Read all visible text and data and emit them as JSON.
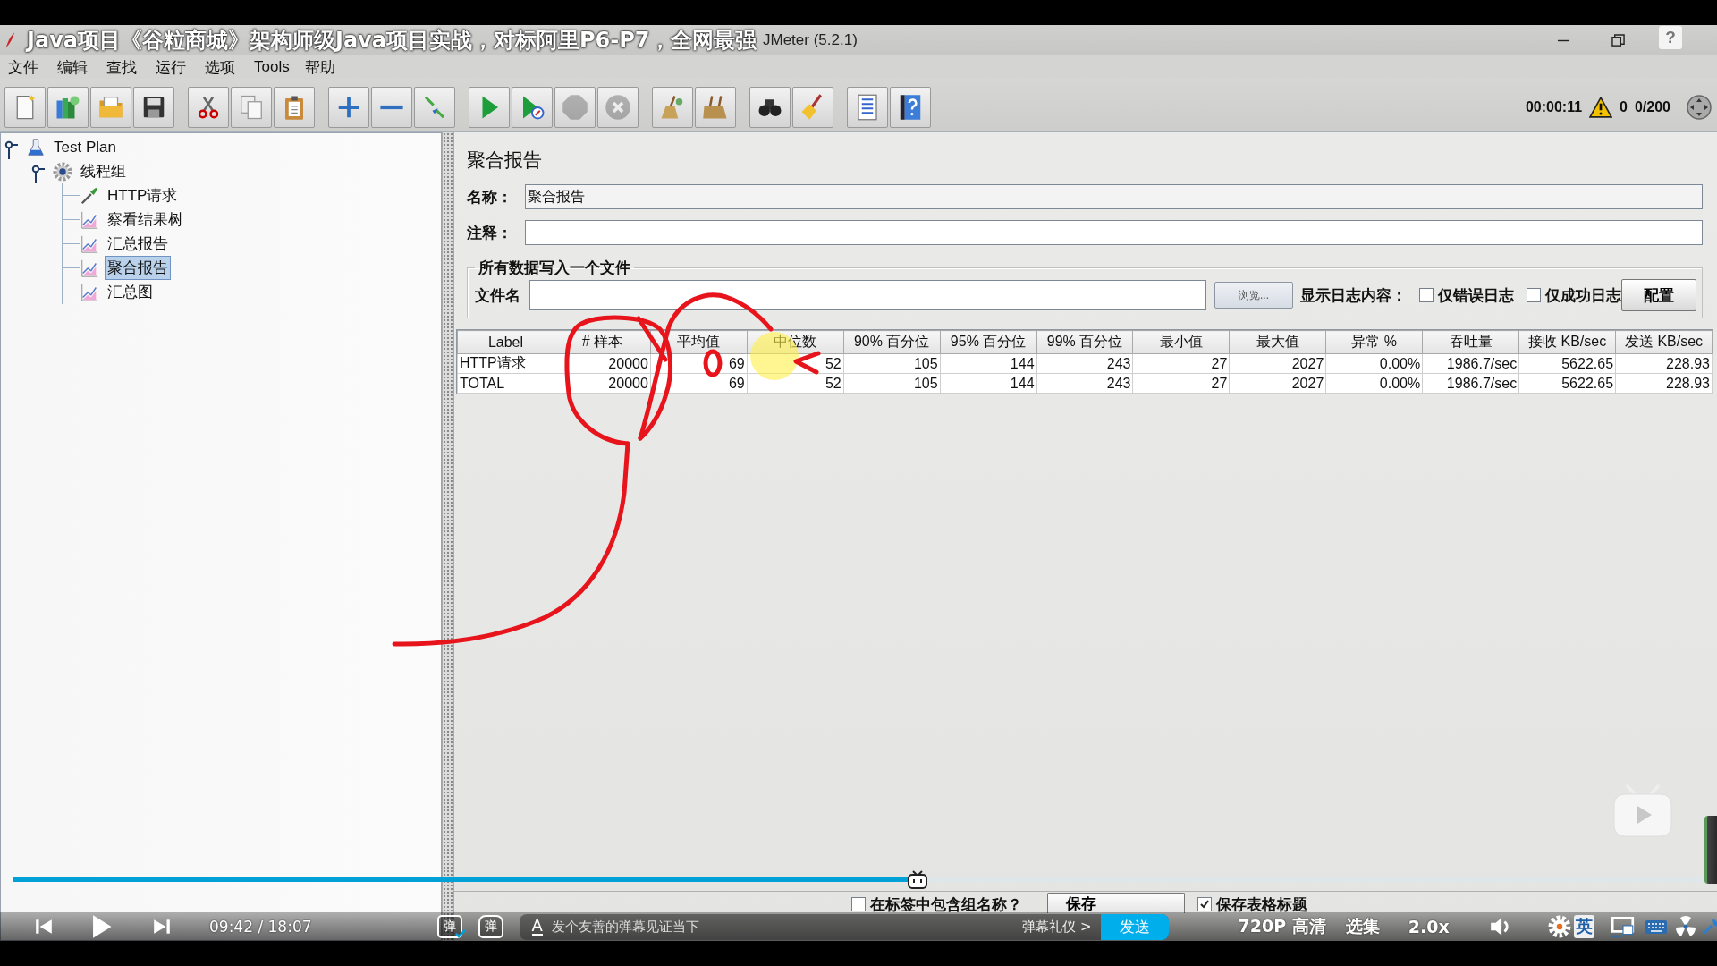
{
  "video_title": "Java项目《谷粒商城》架构师级Java项目实战，对标阿里P6-P7，全网最强",
  "window": {
    "title": "JMeter (5.2.1)",
    "help_bubble": "?"
  },
  "menu": [
    "文件",
    "编辑",
    "查找",
    "运行",
    "选项",
    "Tools",
    "帮助"
  ],
  "toolbar": {
    "groups": [
      [
        {
          "disabled": false
        },
        {
          "disabled": false
        },
        {
          "disabled": false
        },
        {
          "disabled": false
        }
      ],
      [
        {
          "disabled": false
        },
        {
          "disabled": false
        },
        {
          "disabled": false
        }
      ],
      [
        {
          "disabled": false
        },
        {
          "disabled": false
        },
        {
          "disabled": false
        }
      ],
      [
        {
          "disabled": false
        },
        {
          "disabled": false
        },
        {
          "disabled": true
        },
        {
          "disabled": true
        }
      ],
      [
        {
          "disabled": false
        },
        {
          "disabled": false
        }
      ],
      [
        {
          "disabled": false
        },
        {
          "disabled": false
        }
      ],
      [
        {
          "disabled": false
        },
        {
          "disabled": false
        }
      ]
    ],
    "elapsed": "00:00:11",
    "warnings": "0",
    "threads": "0/200"
  },
  "tree": [
    {
      "label": "Test Plan",
      "kind": "test_plan",
      "expanded": true,
      "selected": false,
      "children": [
        {
          "label": "线程组",
          "kind": "thread_group",
          "expanded": true,
          "selected": false,
          "children": [
            {
              "label": "HTTP请求",
              "kind": "sampler",
              "selected": false
            },
            {
              "label": "察看结果树",
              "kind": "listener",
              "selected": false
            },
            {
              "label": "汇总报告",
              "kind": "listener",
              "selected": false
            },
            {
              "label": "聚合报告",
              "kind": "listener",
              "selected": true
            },
            {
              "label": "汇总图",
              "kind": "listener",
              "selected": false
            }
          ]
        }
      ]
    }
  ],
  "panel": {
    "title": "聚合报告",
    "fields": [
      {
        "label": "名称：",
        "value": "聚合报告"
      },
      {
        "label": "注释："
      }
    ],
    "file_group": {
      "legend": "所有数据写入一个文件",
      "filename_label": "文件名",
      "browse_button": "浏览...",
      "log_label": "显示日志内容：",
      "log_options": [
        {
          "label": "仅错误日志",
          "checked": false
        },
        {
          "label": "仅成功日志",
          "checked": false
        }
      ],
      "config_button": "配置"
    },
    "table": {
      "columns": [
        "Label",
        "# 样本",
        "平均值",
        "中位数",
        "90% 百分位",
        "95% 百分位",
        "99% 百分位",
        "最小值",
        "最大值",
        "异常 %",
        "吞吐量",
        "接收 KB/sec",
        "发送 KB/sec"
      ],
      "rows": [
        [
          "HTTP请求",
          "20000",
          "69",
          "52",
          "105",
          "144",
          "243",
          "27",
          "2027",
          "0.00%",
          "1986.7/sec",
          "5622.65",
          "228.93"
        ],
        [
          "TOTAL",
          "20000",
          "69",
          "52",
          "105",
          "144",
          "243",
          "27",
          "2027",
          "0.00%",
          "1986.7/sec",
          "5622.65",
          "228.93"
        ]
      ]
    },
    "footer": {
      "include_group_name": {
        "label": "在标签中包含组名称？",
        "checked": false
      },
      "save_button": "保存",
      "save_headers": {
        "label": "保存表格标题",
        "checked": true
      }
    }
  },
  "player": {
    "progress": {
      "level": 0.535
    },
    "time": "09:42 / 18:07",
    "danmaku_toggle": {
      "label": "弹",
      "on": true
    },
    "danmaku_settings": {
      "label": "弹"
    },
    "danmaku_input": {
      "style_button": "A",
      "placeholder": "发个友善的弹幕见证当下",
      "etiquette_link": "弹幕礼仪 >",
      "send_button": "发送"
    },
    "quality": "720P 高清",
    "episodes": "选集",
    "speed": "2.0x",
    "ime": "英"
  }
}
